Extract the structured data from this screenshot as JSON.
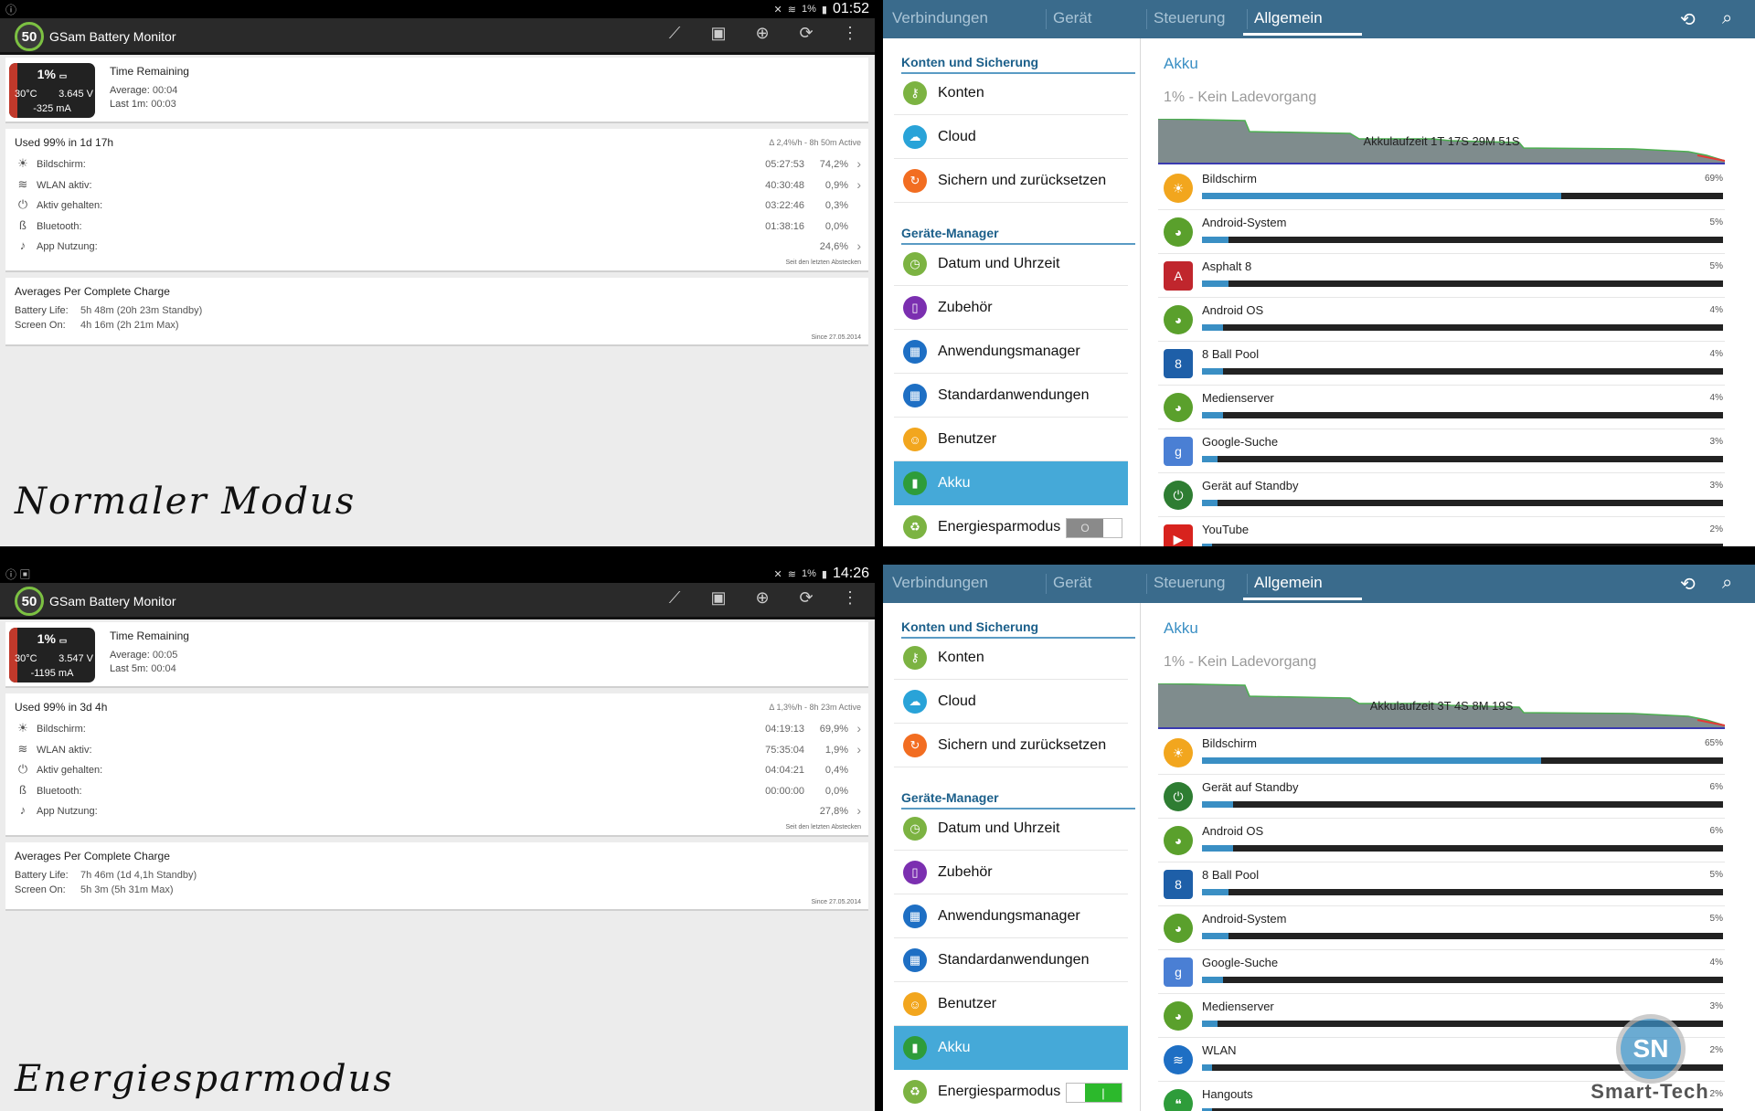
{
  "panels": [
    {
      "status": {
        "left": "ⓘ",
        "signal": "1%",
        "clock": "01:52"
      },
      "gsam": {
        "logo": "50",
        "app_title": "GSam Battery Monitor",
        "battery": {
          "percent": "1%",
          "temp": "30°C",
          "voltage": "3.645 V",
          "current": "-325 mA",
          "level": 0.01
        },
        "time_remaining": {
          "title": "Time Remaining",
          "l1_key": "Average:",
          "l1_val": "00:04",
          "l2_key": "Last 1m:",
          "l2_val": "00:03"
        },
        "used_title": "Used 99% in 1d 17h",
        "used_right": "Δ 2,4%/h - 8h 50m Active",
        "rows": [
          {
            "icon": "screen-icon",
            "glyph": "☀",
            "label": "Bildschirm:",
            "time": "05:27:53",
            "pct": "74,2%",
            "chevron": true
          },
          {
            "icon": "wifi-icon",
            "glyph": "≋",
            "label": "WLAN aktiv:",
            "time": "40:30:48",
            "pct": "0,9%",
            "chevron": true
          },
          {
            "icon": "power-icon",
            "glyph": "⏻",
            "label": "Aktiv gehalten:",
            "time": "03:22:46",
            "pct": "0,3%",
            "chevron": false
          },
          {
            "icon": "bluetooth-icon",
            "glyph": "ß",
            "label": "Bluetooth:",
            "time": "01:38:16",
            "pct": "0,0%",
            "chevron": false
          },
          {
            "icon": "app-usage-icon",
            "glyph": "♪",
            "label": "App Nutzung:",
            "time": "",
            "pct": "24,6%",
            "chevron": true
          }
        ],
        "rows_note": "Seit den letzten Abstecken",
        "averages": {
          "title": "Averages Per Complete Charge",
          "k1": "Battery Life:",
          "v1": "5h 48m (20h 23m Standby)",
          "k2": "Screen On:",
          "v2": "4h 16m (2h 21m Max)",
          "since": "Since 27.05.2014"
        }
      },
      "mode_label": "Normaler Modus",
      "settings": {
        "tabs": [
          "Verbindungen",
          "Gerät",
          "Steuerung",
          "Allgemein"
        ],
        "active_tab": 3,
        "sections": [
          "Konten und Sicherung",
          "Geräte-Manager"
        ],
        "menu": [
          {
            "label": "Konten",
            "glyph": "⚷",
            "color": "#7cb342"
          },
          {
            "label": "Cloud",
            "glyph": "☁",
            "color": "#29a3d8"
          },
          {
            "label": "Sichern und zurücksetzen",
            "glyph": "↻",
            "color": "#f26d21"
          },
          {
            "label": "Datum und Uhrzeit",
            "glyph": "◷",
            "color": "#7cb342"
          },
          {
            "label": "Zubehör",
            "glyph": "▯",
            "color": "#7b2fb0"
          },
          {
            "label": "Anwendungsmanager",
            "glyph": "▦",
            "color": "#1e6fc4"
          },
          {
            "label": "Standardanwendungen",
            "glyph": "▦",
            "color": "#1e6fc4"
          },
          {
            "label": "Benutzer",
            "glyph": "☺",
            "color": "#f2a61e"
          },
          {
            "label": "Akku",
            "glyph": "▮",
            "color": "#2e9c3a"
          },
          {
            "label": "Energiesparmodus",
            "glyph": "♻",
            "color": "#7cb342"
          }
        ],
        "active_menu": 8,
        "toggle_on": false,
        "toggle_glyph": "O",
        "detail_title": "Akku",
        "detail_status": "1% - Kein Ladevorgang",
        "graph_label": "Akkulaufzeit 1T 17S 29M 51S",
        "apps": [
          {
            "name": "Bildschirm",
            "pct": "69%",
            "value": 69,
            "glyph": "☀",
            "color": "#f2a61e",
            "icon": "screen-icon"
          },
          {
            "name": "Android-System",
            "pct": "5%",
            "value": 5,
            "glyph": "◕",
            "color": "#5aa02c",
            "icon": "android-system-icon"
          },
          {
            "name": "Asphalt 8",
            "pct": "5%",
            "value": 5,
            "glyph": "A",
            "color": "#c0262d",
            "icon": "asphalt-icon"
          },
          {
            "name": "Android OS",
            "pct": "4%",
            "value": 4,
            "glyph": "◕",
            "color": "#5aa02c",
            "icon": "android-os-icon"
          },
          {
            "name": "8 Ball Pool",
            "pct": "4%",
            "value": 4,
            "glyph": "8",
            "color": "#1e5fa8",
            "icon": "8ball-icon"
          },
          {
            "name": "Medienserver",
            "pct": "4%",
            "value": 4,
            "glyph": "◕",
            "color": "#5aa02c",
            "icon": "mediaserver-icon"
          },
          {
            "name": "Google-Suche",
            "pct": "3%",
            "value": 3,
            "glyph": "g",
            "color": "#4a7fd4",
            "icon": "google-icon"
          },
          {
            "name": "Gerät auf Standby",
            "pct": "3%",
            "value": 3,
            "glyph": "⏻",
            "color": "#2e7d32",
            "icon": "standby-icon"
          },
          {
            "name": "YouTube",
            "pct": "2%",
            "value": 2,
            "glyph": "▶",
            "color": "#d8231e",
            "icon": "youtube-icon"
          }
        ]
      }
    },
    {
      "status": {
        "left": "ⓘ ▣",
        "signal": "1%",
        "clock": "14:26"
      },
      "gsam": {
        "logo": "50",
        "app_title": "GSam Battery Monitor",
        "battery": {
          "percent": "1%",
          "temp": "30°C",
          "voltage": "3.547 V",
          "current": "-1195 mA",
          "level": 0.01
        },
        "time_remaining": {
          "title": "Time Remaining",
          "l1_key": "Average:",
          "l1_val": "00:05",
          "l2_key": "Last 5m:",
          "l2_val": "00:04"
        },
        "used_title": "Used 99% in 3d 4h",
        "used_right": "Δ 1,3%/h - 8h 23m Active",
        "rows": [
          {
            "icon": "screen-icon",
            "glyph": "☀",
            "label": "Bildschirm:",
            "time": "04:19:13",
            "pct": "69,9%",
            "chevron": true
          },
          {
            "icon": "wifi-icon",
            "glyph": "≋",
            "label": "WLAN aktiv:",
            "time": "75:35:04",
            "pct": "1,9%",
            "chevron": true
          },
          {
            "icon": "power-icon",
            "glyph": "⏻",
            "label": "Aktiv gehalten:",
            "time": "04:04:21",
            "pct": "0,4%",
            "chevron": false
          },
          {
            "icon": "bluetooth-icon",
            "glyph": "ß",
            "label": "Bluetooth:",
            "time": "00:00:00",
            "pct": "0,0%",
            "chevron": false
          },
          {
            "icon": "app-usage-icon",
            "glyph": "♪",
            "label": "App Nutzung:",
            "time": "",
            "pct": "27,8%",
            "chevron": true
          }
        ],
        "rows_note": "Seit den letzten Abstecken",
        "averages": {
          "title": "Averages Per Complete Charge",
          "k1": "Battery Life:",
          "v1": "7h 46m (1d 4,1h Standby)",
          "k2": "Screen On:",
          "v2": "5h 3m (5h 31m Max)",
          "since": "Since 27.05.2014"
        }
      },
      "mode_label": "Energiesparmodus",
      "settings": {
        "tabs": [
          "Verbindungen",
          "Gerät",
          "Steuerung",
          "Allgemein"
        ],
        "active_tab": 3,
        "sections": [
          "Konten und Sicherung",
          "Geräte-Manager"
        ],
        "menu": [
          {
            "label": "Konten",
            "glyph": "⚷",
            "color": "#7cb342"
          },
          {
            "label": "Cloud",
            "glyph": "☁",
            "color": "#29a3d8"
          },
          {
            "label": "Sichern und zurücksetzen",
            "glyph": "↻",
            "color": "#f26d21"
          },
          {
            "label": "Datum und Uhrzeit",
            "glyph": "◷",
            "color": "#7cb342"
          },
          {
            "label": "Zubehör",
            "glyph": "▯",
            "color": "#7b2fb0"
          },
          {
            "label": "Anwendungsmanager",
            "glyph": "▦",
            "color": "#1e6fc4"
          },
          {
            "label": "Standardanwendungen",
            "glyph": "▦",
            "color": "#1e6fc4"
          },
          {
            "label": "Benutzer",
            "glyph": "☺",
            "color": "#f2a61e"
          },
          {
            "label": "Akku",
            "glyph": "▮",
            "color": "#2e9c3a"
          },
          {
            "label": "Energiesparmodus",
            "glyph": "♻",
            "color": "#7cb342"
          }
        ],
        "active_menu": 8,
        "toggle_on": true,
        "toggle_glyph": "|",
        "detail_title": "Akku",
        "detail_status": "1% - Kein Ladevorgang",
        "graph_label": "Akkulaufzeit 3T 4S 8M 19S",
        "apps": [
          {
            "name": "Bildschirm",
            "pct": "65%",
            "value": 65,
            "glyph": "☀",
            "color": "#f2a61e",
            "icon": "screen-icon"
          },
          {
            "name": "Gerät auf Standby",
            "pct": "6%",
            "value": 6,
            "glyph": "⏻",
            "color": "#2e7d32",
            "icon": "standby-icon"
          },
          {
            "name": "Android OS",
            "pct": "6%",
            "value": 6,
            "glyph": "◕",
            "color": "#5aa02c",
            "icon": "android-os-icon"
          },
          {
            "name": "8 Ball Pool",
            "pct": "5%",
            "value": 5,
            "glyph": "8",
            "color": "#1e5fa8",
            "icon": "8ball-icon"
          },
          {
            "name": "Android-System",
            "pct": "5%",
            "value": 5,
            "glyph": "◕",
            "color": "#5aa02c",
            "icon": "android-system-icon"
          },
          {
            "name": "Google-Suche",
            "pct": "4%",
            "value": 4,
            "glyph": "g",
            "color": "#4a7fd4",
            "icon": "google-icon"
          },
          {
            "name": "Medienserver",
            "pct": "3%",
            "value": 3,
            "glyph": "◕",
            "color": "#5aa02c",
            "icon": "mediaserver-icon"
          },
          {
            "name": "WLAN",
            "pct": "2%",
            "value": 2,
            "glyph": "≋",
            "color": "#1e6fc4",
            "icon": "wlan-icon"
          },
          {
            "name": "Hangouts",
            "pct": "2%",
            "value": 2,
            "glyph": "❝",
            "color": "#2e9c3a",
            "icon": "hangouts-icon"
          }
        ]
      }
    }
  ],
  "watermark": {
    "logo": "SN",
    "text": "Smart-Tech"
  }
}
